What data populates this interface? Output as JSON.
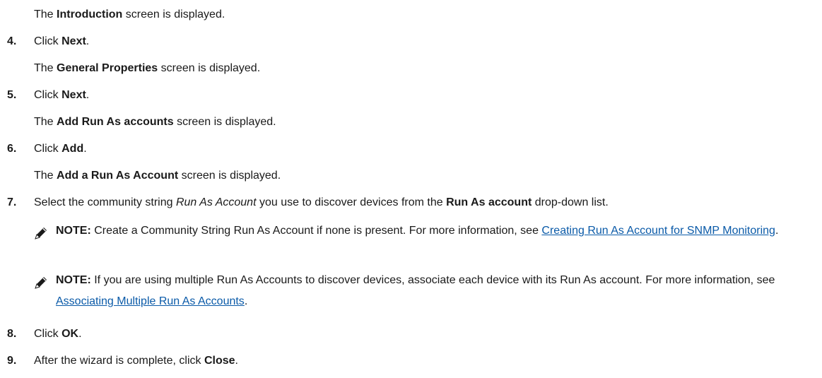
{
  "intro_line": {
    "pre": "The ",
    "bold": "Introduction",
    "post": " screen is displayed."
  },
  "steps": [
    {
      "number": "4.",
      "action": {
        "pre": "Click ",
        "bold": "Next",
        "post": "."
      },
      "result": {
        "pre": "The ",
        "bold": "General Properties",
        "post": " screen is displayed."
      }
    },
    {
      "number": "5.",
      "action": {
        "pre": "Click ",
        "bold": "Next",
        "post": "."
      },
      "result": {
        "pre": "The ",
        "bold": "Add Run As accounts",
        "post": " screen is displayed."
      }
    },
    {
      "number": "6.",
      "action": {
        "pre": "Click ",
        "bold": "Add",
        "post": "."
      },
      "result": {
        "pre": "The ",
        "bold": "Add a Run As Account",
        "post": " screen is displayed."
      }
    },
    {
      "number": "7.",
      "action": {
        "pre": "Select the community string ",
        "italic": "Run As Account",
        "mid": " you use to discover devices from the ",
        "bold": "Run As account",
        "post": " drop-down list."
      }
    },
    {
      "number": "8.",
      "action": {
        "pre": "Click ",
        "bold": "OK",
        "post": "."
      }
    },
    {
      "number": "9.",
      "action": {
        "pre": "After the wizard is complete, click ",
        "bold": "Close",
        "post": "."
      }
    }
  ],
  "notes": [
    {
      "label": "NOTE:",
      "text": " Create a Community String Run As Account if none is present. For more information, see ",
      "link": "Creating Run As Account for SNMP Monitoring",
      "post": "."
    },
    {
      "label": "NOTE:",
      "text": " If you are using multiple Run As Accounts to discover devices, associate each device with its Run As account. For more information, see ",
      "link": "Associating Multiple Run As Accounts",
      "post": "."
    }
  ],
  "icons": {
    "note": "pencil-note-icon"
  }
}
